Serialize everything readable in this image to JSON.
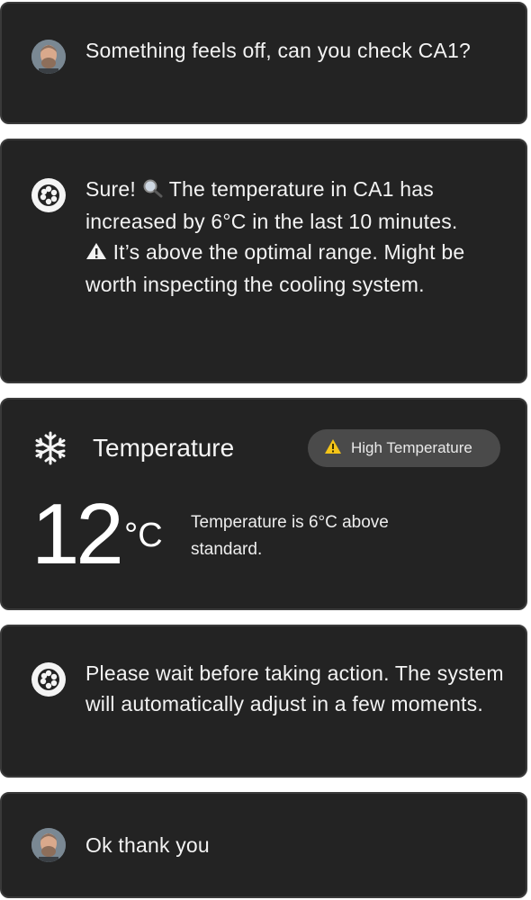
{
  "messages": [
    {
      "role": "user",
      "text": "Something feels off, can you check CA1?"
    },
    {
      "role": "assistant",
      "line1_prefix": "Sure!",
      "line1_emoji": "magnifier-icon",
      "line1_suffix": "The temperature in CA1 has increased by 6°C in the last 10 minutes.",
      "line2_emoji": "warning-icon",
      "line2_text": "It’s above the optimal range. Might be worth inspecting the cooling system."
    },
    {
      "role": "assistant",
      "text": "Please wait before taking action. The system will automatically adjust in a few moments."
    },
    {
      "role": "user",
      "text": "Ok thank you"
    }
  ],
  "temperature_widget": {
    "icon": "snowflake-icon",
    "title": "Temperature",
    "badge": {
      "icon": "warning-icon",
      "label": "High Temperature",
      "color": "#f5c518"
    },
    "value": "12",
    "unit": "°C",
    "note": "Temperature is 6°C above standard."
  },
  "colors": {
    "card_bg": "#232323",
    "card_border": "#3a3a3a",
    "badge_bg": "#4a4a4a",
    "text": "#f3f3f3"
  }
}
